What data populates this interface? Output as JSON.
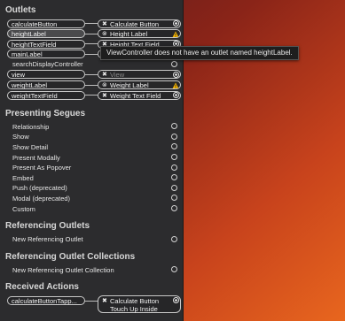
{
  "outlets": {
    "title": "Outlets",
    "items": [
      {
        "name": "calculateButton",
        "target": "Calculate Button",
        "state": "ok"
      },
      {
        "name": "heightLabel",
        "target": "Height Label",
        "state": "warning"
      },
      {
        "name": "heightTextField",
        "target": "Height Text Field",
        "state": "ok"
      },
      {
        "name": "mainLabel",
        "target": "",
        "state": "ok"
      },
      {
        "name": "searchDisplayController",
        "target": "",
        "state": "none"
      },
      {
        "name": "view",
        "target": "View",
        "state": "ok"
      },
      {
        "name": "weightLabel",
        "target": "Weight Label",
        "state": "warning"
      },
      {
        "name": "weightTextField",
        "target": "Weight Text Field",
        "state": "ok"
      }
    ]
  },
  "segues": {
    "title": "Presenting Segues",
    "items": [
      "Relationship",
      "Show",
      "Show Detail",
      "Present Modally",
      "Present As Popover",
      "Embed",
      "Push (deprecated)",
      "Modal (deprecated)",
      "Custom"
    ]
  },
  "referencing_outlets": {
    "title": "Referencing Outlets",
    "item": "New Referencing Outlet"
  },
  "referencing_collections": {
    "title": "Referencing Outlet Collections",
    "item": "New Referencing Outlet Collection"
  },
  "received_actions": {
    "title": "Received Actions",
    "action": "calculateButtonTapp...",
    "target_line1": "Calculate Button",
    "target_line2": "Touch Up Inside"
  },
  "tooltip": "ViewController does not have an outlet named heightLabel.",
  "colors": {
    "panel_bg": "#2c2c2e",
    "warning": "#f5b400"
  }
}
